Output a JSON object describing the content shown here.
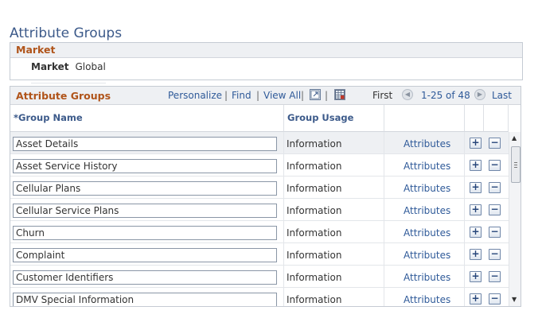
{
  "page": {
    "title": "Attribute Groups"
  },
  "market": {
    "section_title": "Market",
    "label": "Market",
    "value": "Global"
  },
  "grid": {
    "title": "Attribute Groups",
    "links": {
      "personalize": "Personalize",
      "find": "Find",
      "view_all": "View All"
    },
    "separator": "|",
    "pager": {
      "first": "First",
      "range": "1-25 of 48",
      "last": "Last"
    },
    "columns": {
      "group_name": "*Group Name",
      "group_usage": "Group Usage"
    },
    "rows": [
      {
        "name": "Asset Details",
        "usage": "Information",
        "link": "Attributes"
      },
      {
        "name": "Asset Service History",
        "usage": "Information",
        "link": "Attributes"
      },
      {
        "name": "Cellular Plans",
        "usage": "Information",
        "link": "Attributes"
      },
      {
        "name": "Cellular Service Plans",
        "usage": "Information",
        "link": "Attributes"
      },
      {
        "name": "Churn",
        "usage": "Information",
        "link": "Attributes"
      },
      {
        "name": "Complaint",
        "usage": "Information",
        "link": "Attributes"
      },
      {
        "name": "Customer Identifiers",
        "usage": "Information",
        "link": "Attributes"
      },
      {
        "name": "DMV Special Information",
        "usage": "Information",
        "link": "Attributes"
      }
    ],
    "add_symbol": "+",
    "delete_symbol": "−"
  },
  "colors": {
    "title_blue": "#3c5a8a",
    "section_orange": "#b0541a",
    "link_blue": "#2f5a99"
  },
  "icons": [
    "zoom-grid-icon",
    "download-spreadsheet-icon",
    "prev-page-icon",
    "next-page-icon",
    "scroll-up-icon",
    "scroll-down-icon"
  ]
}
